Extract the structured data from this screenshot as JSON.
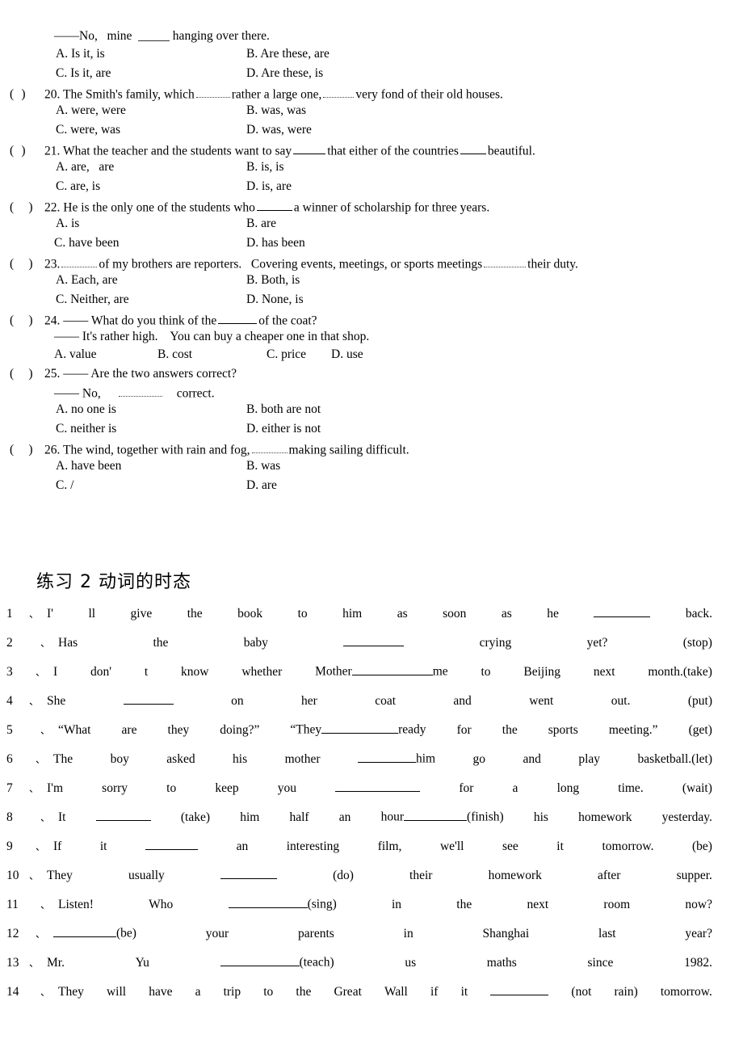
{
  "document": {
    "type": "english-grammar-worksheet",
    "page_background": "#ffffff",
    "text_color": "#000000"
  },
  "multiple_choice": {
    "lead_line": "——No,   mine  _____ hanging over there.",
    "lead_options": {
      "a": "A. Is it, is",
      "b": "B. Are these, are",
      "c": "C. Is it, are",
      "d": "D. Are these, is"
    },
    "questions": [
      {
        "marker": "(  )",
        "number": "20.",
        "stem_before": "20. The Smith's family, which",
        "stem_mid": "rather a large one,",
        "stem_after": "very fond of their old houses.",
        "options": {
          "a": "A. were, were",
          "b": "B. was, was",
          "c": "C. were, was",
          "d": "D. was, were"
        }
      },
      {
        "marker": "(  )",
        "number": "21.",
        "stem_before": "21. What the teacher and the students want to say",
        "stem_mid": "that either of the countries",
        "stem_after": "beautiful.",
        "options": {
          "a": "A. are,   are",
          "b": "B. is, is",
          "c": "C. are, is",
          "d": "D. is, are"
        }
      },
      {
        "marker": "(  )",
        "number": "22.",
        "stem_before": "22. He is the only one of the students who",
        "stem_mid": "a winner of scholarship for three years.",
        "stem_after": "",
        "options": {
          "a": "A. is",
          "b": "B. are",
          "c": "C. have been",
          "d": "D. has been"
        }
      },
      {
        "marker": "(  )",
        "number": "23.",
        "stem_before": "23.",
        "stem_mid": "of my brothers are reporters.   Covering events, meetings, or sports meetings",
        "stem_after": "their duty.",
        "options": {
          "a": "A. Each, are",
          "b": "B. Both, is",
          "c": "C. Neither, are",
          "d": "D. None, is"
        }
      }
    ],
    "q24": {
      "marker": "(  )",
      "line1_before": "24. —— What do you think of the",
      "line1_after": "of the coat?",
      "line2": "—— It's rather high.    You can buy a cheaper one in that shop.",
      "options": {
        "a": "A. value",
        "b": "B. cost",
        "c": "C. price",
        "d": "D. use"
      }
    },
    "q25": {
      "marker": "(  )",
      "line1": "25. —— Are the two answers correct?",
      "line2_before": "—— No,",
      "line2_after": "correct.",
      "options": {
        "a": "A. no one is",
        "b": "B. both are not",
        "c": "C. neither is",
        "d": "D. either is not"
      }
    },
    "q26": {
      "marker": "(  )",
      "stem_before": "26. The wind, together with rain and fog,",
      "stem_after": "making sailing difficult.",
      "options": {
        "a": "A. have been",
        "b": "B. was",
        "c": "C. /",
        "d": "D. are"
      }
    }
  },
  "section2": {
    "heading": "练习 2 动词的时态",
    "enum_comma": "、",
    "items": [
      {
        "num": "1",
        "tokens": [
          "I'",
          "ll",
          "give",
          "the",
          "book",
          "to",
          "him",
          "as",
          "soon",
          "as",
          "he",
          "____BLANK70____",
          "back."
        ],
        "hint": ""
      },
      {
        "num": "2",
        "tokens": [
          "Has",
          "the",
          "baby",
          "____BLANK75____",
          "crying",
          "yet?",
          "(stop)"
        ],
        "hint": "(stop)"
      },
      {
        "num": "3",
        "tokens": [
          "I",
          "don'",
          "t",
          "know",
          "whether",
          "Mother____BLANK100____me",
          "to",
          "Beijing",
          "next",
          "month.(take)"
        ],
        "hint": "(take)"
      },
      {
        "num": "4",
        "tokens": [
          "She",
          "____BLANK62____",
          "on",
          "her",
          "coat",
          "and",
          "went",
          "out.",
          "(put)"
        ],
        "hint": "(put)"
      },
      {
        "num": "5",
        "tokens": [
          "“What",
          "are",
          "they",
          "doing?”",
          "“They____BLANK95____ready",
          "for",
          "the",
          "sports",
          "meeting.”",
          "(get)"
        ],
        "hint": "(get)"
      },
      {
        "num": "6",
        "tokens": [
          "The",
          "boy",
          "asked",
          "his",
          "mother",
          "____BLANK72____him",
          "go",
          "and",
          "play",
          "basketball.(let)"
        ],
        "hint": "(let)"
      },
      {
        "num": "7",
        "tokens": [
          "I'm",
          "sorry",
          "to",
          "keep",
          "you",
          "____BLANK105____",
          "for",
          "a",
          "long",
          "time.",
          "(wait)"
        ],
        "hint": "(wait)"
      },
      {
        "num": "8",
        "tokens": [
          "It",
          "____BLANK68____",
          "(take)",
          "him",
          "half",
          "an",
          "hour____BLANK78____(finish)",
          "his",
          "homework",
          "yesterday."
        ],
        "hint": "(take) (finish)"
      },
      {
        "num": "9",
        "tokens": [
          "If",
          "it",
          "____BLANK65____",
          "an",
          "interesting",
          "film,",
          "we'll",
          "see",
          "it",
          "tomorrow.",
          "(be)"
        ],
        "hint": "(be)"
      },
      {
        "num": "10",
        "tokens": [
          "They",
          "usually",
          "____BLANK70____",
          "(do)",
          "their",
          "homework",
          "after",
          "supper."
        ],
        "hint": "(do)"
      },
      {
        "num": "11",
        "tokens": [
          "Listen!",
          "Who",
          "____BLANK98____(sing)",
          "in",
          "the",
          "next",
          "room",
          "now?"
        ],
        "hint": "(sing)"
      },
      {
        "num": "12",
        "tokens": [
          "____BLANK78____(be)",
          "your",
          "parents",
          "in",
          "Shanghai",
          "last",
          "year?"
        ],
        "hint": "(be)"
      },
      {
        "num": "13",
        "tokens": [
          "Mr.",
          "Yu",
          "____BLANK98____(teach)",
          "us",
          "maths",
          "since",
          "1982."
        ],
        "hint": "(teach)"
      },
      {
        "num": "14",
        "tokens": [
          "They",
          "will",
          "have",
          "a",
          "trip",
          "to",
          "the",
          "Great",
          "Wall",
          "if",
          "it",
          "____BLANK72____",
          "(not",
          "rain)",
          "tomorrow."
        ],
        "hint": "(not rain)"
      }
    ]
  }
}
